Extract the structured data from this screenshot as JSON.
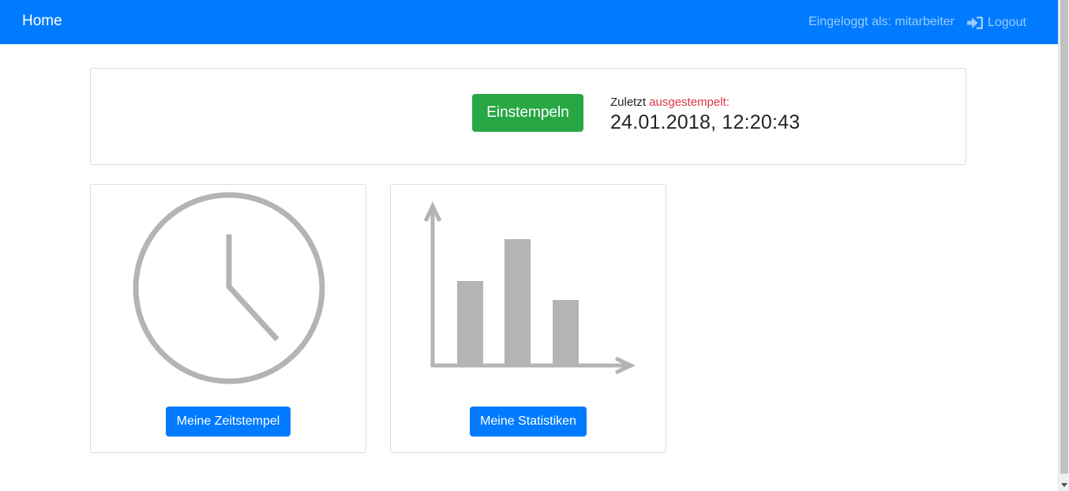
{
  "navbar": {
    "brand": "Home",
    "logged_in_as": "Eingeloggt als: mitarbeiter",
    "logout_label": "Logout",
    "color": "#007bff"
  },
  "stamp": {
    "button_label": "Einstempeln",
    "button_color": "#28a745",
    "last_prefix": "Zuletzt",
    "last_status": "ausgestempelt:",
    "status_color": "#dc3545",
    "last_datetime": "24.01.2018, 12:20:43"
  },
  "cards": {
    "timestamps": {
      "icon": "clock-icon",
      "button_label": "Meine Zeitstempel"
    },
    "statistics": {
      "icon": "bar-chart-icon",
      "button_label": "Meine Statistiken"
    }
  }
}
